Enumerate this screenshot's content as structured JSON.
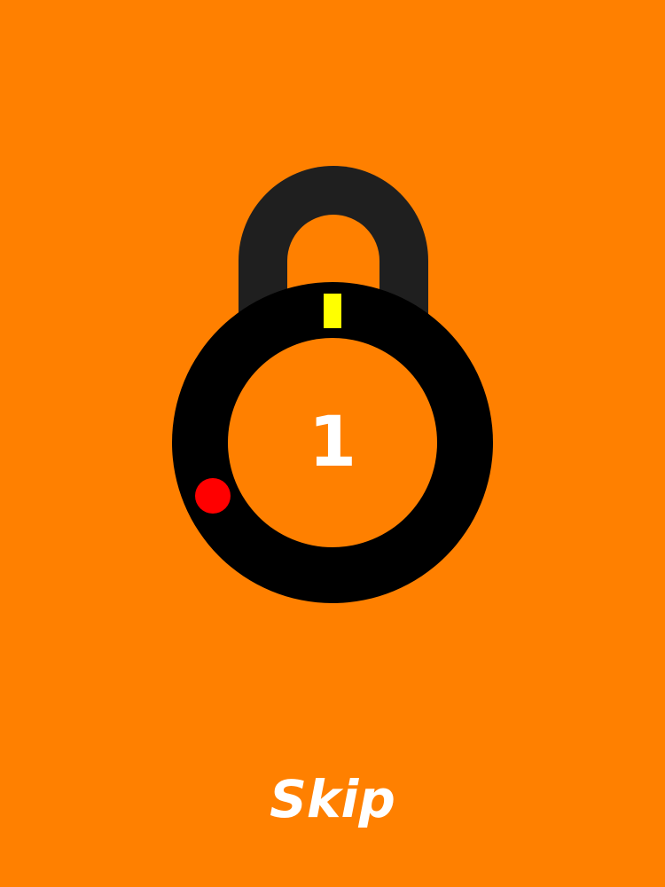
{
  "game": {
    "remaining_count": "1",
    "skip_label": "Skip"
  },
  "lock": {
    "shackle_icon": "padlock-shackle-icon",
    "marker_icon": "yellow-needle-marker",
    "target_icon": "red-target-dot"
  },
  "colors": {
    "background": "#ff8000",
    "shackle": "#1f1f1f",
    "dial": "#000000",
    "marker": "#ffff00",
    "target": "#ff0000",
    "text": "#ffffff"
  }
}
